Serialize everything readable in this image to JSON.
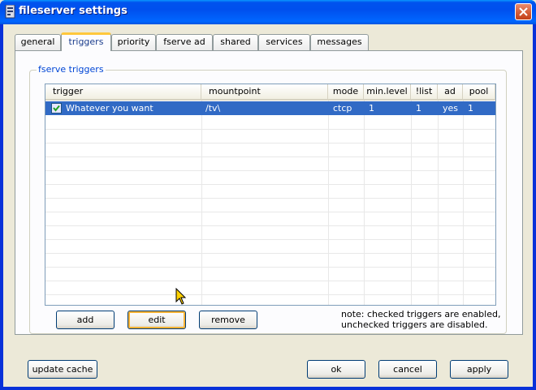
{
  "window": {
    "title": "fileserver settings"
  },
  "tabs": [
    {
      "label": "general"
    },
    {
      "label": "triggers"
    },
    {
      "label": "priority"
    },
    {
      "label": "fserve ad"
    },
    {
      "label": "shared"
    },
    {
      "label": "services"
    },
    {
      "label": "messages"
    }
  ],
  "group": {
    "label": "fserve triggers"
  },
  "table": {
    "columns": [
      "trigger",
      "mountpoint",
      "mode",
      "min.level",
      "!list",
      "ad",
      "pool"
    ],
    "rows": [
      {
        "checked": true,
        "trigger": "Whatever you want",
        "mountpoint": "/tv\\",
        "mode": "ctcp",
        "min_level": "1",
        "list": "1",
        "ad": "yes",
        "pool": "1"
      }
    ]
  },
  "buttons": {
    "add": "add",
    "edit": "edit",
    "remove": "remove"
  },
  "note": {
    "line1": "note: checked triggers are enabled,",
    "line2": "unchecked triggers are disabled."
  },
  "footer": {
    "update_cache": "update cache",
    "ok": "ok",
    "cancel": "cancel",
    "apply": "apply"
  },
  "colors": {
    "titlebar": "#0054e3",
    "selection": "#316ac5",
    "group_label": "#0046d5",
    "tab_highlight": "#ffc83c"
  },
  "icons": {
    "window": "file-server-icon",
    "close": "close-icon",
    "check": "check-icon",
    "cursor": "mouse-pointer-icon"
  }
}
